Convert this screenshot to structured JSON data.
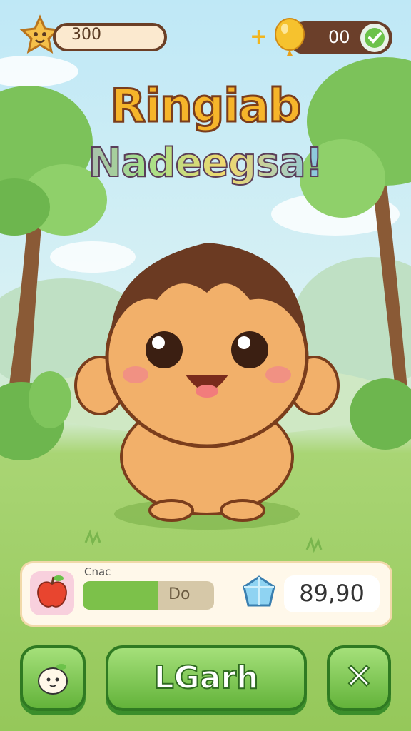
{
  "hud": {
    "coin_value": "300",
    "plus_label": "+",
    "gem_value": "00"
  },
  "title": {
    "line1": "Ringiab",
    "line2": "Nadeegsa!"
  },
  "status_panel": {
    "bar_label": "Cnac",
    "bar_value": "Do",
    "bar_progress": 0.57,
    "score_value": "89,90"
  },
  "actions": {
    "main_button_label": "LGarh",
    "close_label": "✕"
  },
  "colors": {
    "accent_green": "#63b33a",
    "title_orange": "#f6b52a",
    "panel_bg": "#fff8ea"
  },
  "icons": {
    "coin": "star-coin-icon",
    "gem": "golden-balloon-icon",
    "check": "check-icon",
    "apple": "apple-icon",
    "crystal": "crystal-icon",
    "mascot": "seed-mascot-icon",
    "close": "close-icon"
  }
}
